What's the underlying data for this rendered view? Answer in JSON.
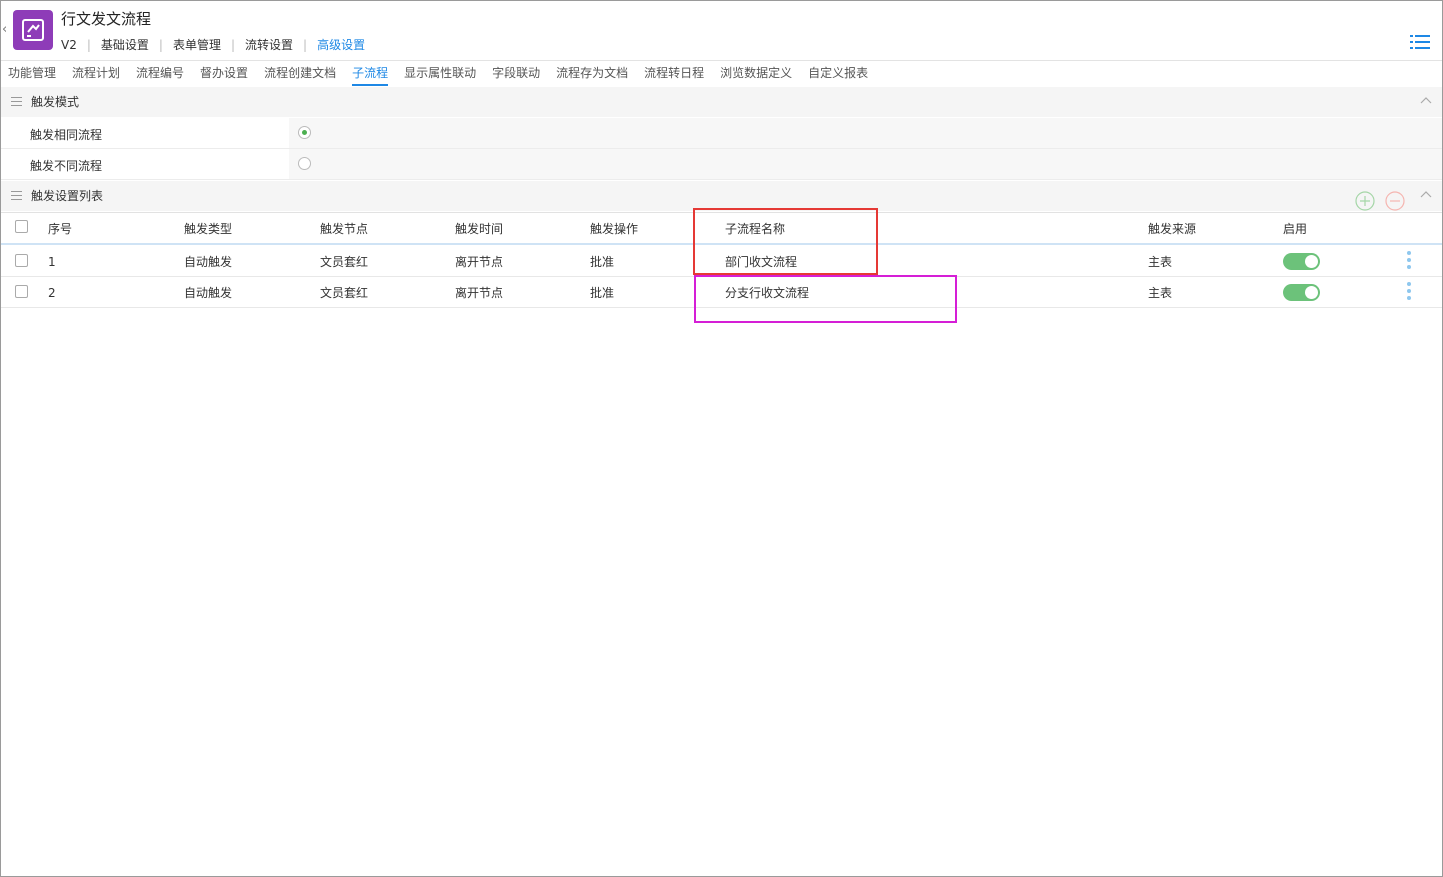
{
  "header": {
    "title": "行文发文流程",
    "version": "V2",
    "nav": [
      {
        "label": "基础设置",
        "active": false
      },
      {
        "label": "表单管理",
        "active": false
      },
      {
        "label": "流转设置",
        "active": false
      },
      {
        "label": "高级设置",
        "active": true
      }
    ]
  },
  "tabs": [
    {
      "label": "功能管理",
      "active": false
    },
    {
      "label": "流程计划",
      "active": false
    },
    {
      "label": "流程编号",
      "active": false
    },
    {
      "label": "督办设置",
      "active": false
    },
    {
      "label": "流程创建文档",
      "active": false
    },
    {
      "label": "子流程",
      "active": true
    },
    {
      "label": "显示属性联动",
      "active": false
    },
    {
      "label": "字段联动",
      "active": false
    },
    {
      "label": "流程存为文档",
      "active": false
    },
    {
      "label": "流程转日程",
      "active": false
    },
    {
      "label": "浏览数据定义",
      "active": false
    },
    {
      "label": "自定义报表",
      "active": false
    }
  ],
  "trigger_mode": {
    "title": "触发模式",
    "options": [
      {
        "label": "触发相同流程",
        "checked": true
      },
      {
        "label": "触发不同流程",
        "checked": false
      }
    ]
  },
  "trigger_list": {
    "title": "触发设置列表",
    "columns": {
      "index": "序号",
      "type": "触发类型",
      "node": "触发节点",
      "time": "触发时间",
      "operation": "触发操作",
      "subflow": "子流程名称",
      "source": "触发来源",
      "enabled": "启用"
    },
    "rows": [
      {
        "index": "1",
        "type": "自动触发",
        "node": "文员套红",
        "time": "离开节点",
        "operation": "批准",
        "subflow": "部门收文流程",
        "source": "主表",
        "enabled": true
      },
      {
        "index": "2",
        "type": "自动触发",
        "node": "文员套红",
        "time": "离开节点",
        "operation": "批准",
        "subflow": "分支行收文流程",
        "source": "主表",
        "enabled": true
      }
    ]
  },
  "colors": {
    "accent": "#1e88e5",
    "app_icon": "#8e3cb8",
    "toggle_on": "#6cc27a",
    "annotation_red": "#e53935",
    "annotation_magenta": "#d51ed6"
  }
}
